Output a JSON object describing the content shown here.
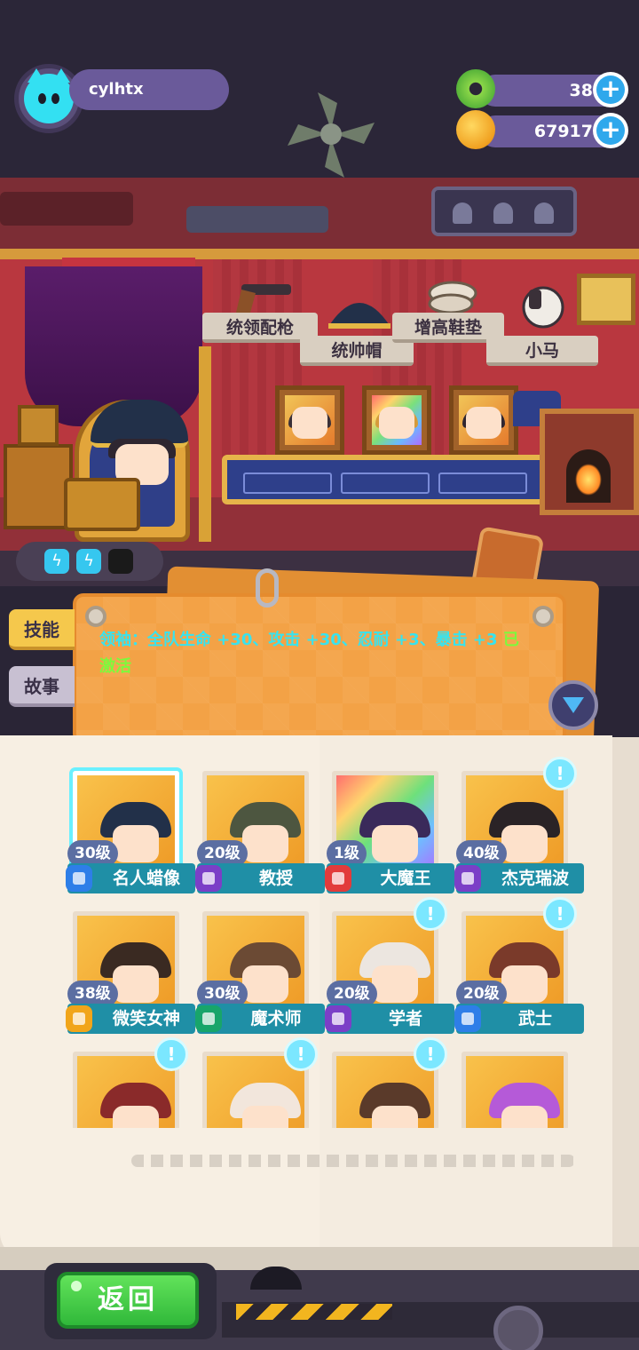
{
  "player": {
    "name": "cylhtx"
  },
  "resources": [
    {
      "name": "donut",
      "value": "38",
      "icon": "donut-icon",
      "color": "#57b33a"
    },
    {
      "name": "coin",
      "value": "67917",
      "icon": "coin-icon",
      "color": "#f0a020"
    }
  ],
  "room": {
    "items": [
      {
        "label": "统领配枪"
      },
      {
        "label": "统帅帽"
      },
      {
        "label": "增高鞋垫"
      },
      {
        "label": "小马"
      }
    ],
    "energy": {
      "filled": 2,
      "total": 3
    }
  },
  "panel": {
    "tabs": [
      {
        "label": "技能"
      },
      {
        "label": "故事"
      }
    ],
    "skill_text": "领袖：全队生命 +30、攻击 +30、忍耐 +3、暴击 +3",
    "skill_status": "已激活"
  },
  "characters": [
    {
      "level": "30级",
      "name": "名人蜡像",
      "badge": "blue",
      "selected": true,
      "rainbow": false,
      "hair": "#223049"
    },
    {
      "level": "20级",
      "name": "教授",
      "badge": "purple",
      "alert": false,
      "hair": "#4d5640"
    },
    {
      "level": "1级",
      "name": "大魔王",
      "badge": "red",
      "rainbow": true,
      "hair": "#3a2a5a"
    },
    {
      "level": "40级",
      "name": "杰克瑞波",
      "badge": "purple",
      "alert": true,
      "hair": "#2a2326"
    },
    {
      "level": "38级",
      "name": "微笑女神",
      "badge": "gold",
      "hair": "#3a2a22"
    },
    {
      "level": "30级",
      "name": "魔术师",
      "badge": "green",
      "hair": "#6b4a34"
    },
    {
      "level": "20级",
      "name": "学者",
      "badge": "purple",
      "alert": true,
      "hair": "#ece6e0"
    },
    {
      "level": "20级",
      "name": "武士",
      "badge": "blue",
      "alert": true,
      "hair": "#7a3a2a"
    },
    {
      "level": "",
      "name": "",
      "badge": "",
      "alert": true,
      "hair": "#8a2a2a"
    },
    {
      "level": "",
      "name": "",
      "badge": "",
      "alert": true,
      "hair": "#f2e6dc"
    },
    {
      "level": "",
      "name": "",
      "badge": "",
      "alert": true,
      "hair": "#5a3a2a"
    },
    {
      "level": "",
      "name": "",
      "badge": "",
      "alert": false,
      "hair": "#b55ad8"
    }
  ],
  "footer": {
    "back_label": "返回"
  },
  "colors": {
    "accent_cyan": "#38e3ee",
    "active_green": "#7cfb3c",
    "name_bar": "#1f8fa6"
  }
}
